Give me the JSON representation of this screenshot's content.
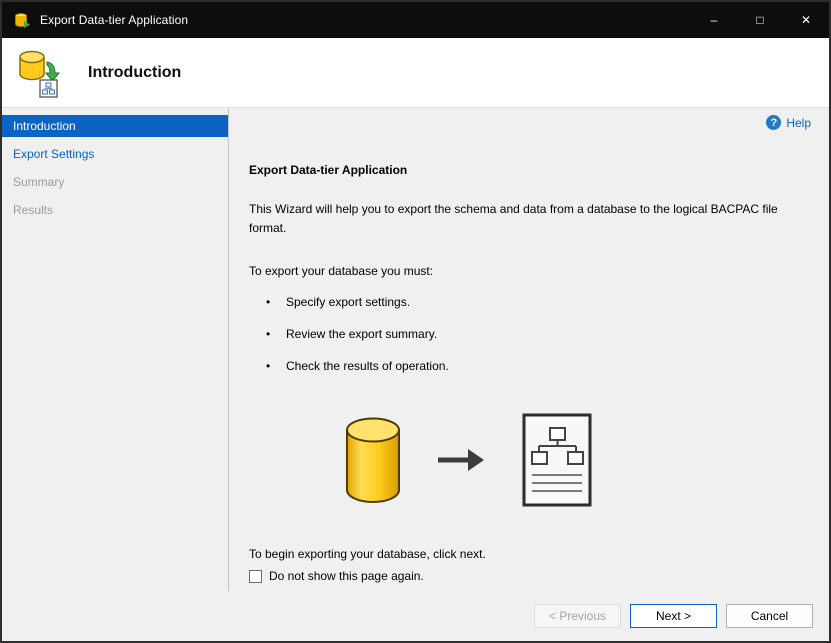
{
  "window": {
    "title": "Export Data-tier Application",
    "controls": {
      "minimize": "–",
      "maximize": "□",
      "close": "✕"
    }
  },
  "header": {
    "title": "Introduction"
  },
  "sidebar": {
    "items": [
      {
        "label": "Introduction",
        "state": "active"
      },
      {
        "label": "Export Settings",
        "state": "enabled"
      },
      {
        "label": "Summary",
        "state": "disabled"
      },
      {
        "label": "Results",
        "state": "disabled"
      }
    ]
  },
  "content": {
    "help_label": "Help",
    "heading": "Export Data-tier Application",
    "intro": "This Wizard will help you to export the schema and data from a database to the logical BACPAC file format.",
    "must_label": "To export your database you must:",
    "bullets": [
      "Specify export settings.",
      "Review the export summary.",
      "Check the results of operation."
    ],
    "begin_text": "To begin exporting your database, click next.",
    "checkbox_label": "Do not show this page again.",
    "checkbox_checked": false
  },
  "buttons": {
    "previous": "< Previous",
    "next": "Next >",
    "cancel": "Cancel"
  },
  "icons": {
    "help": "question-mark-in-blue-circle",
    "title_bar": "database-export-icon",
    "header": "database-export-icon",
    "illustration": [
      "database-cylinder",
      "arrow-right",
      "bacpac-file"
    ]
  },
  "colors": {
    "accent": "#0b64c4",
    "link": "#0066cc",
    "titlebar": "#0d0d0d",
    "background": "#f0f0f0",
    "database_yellow": "#ffcc1a"
  }
}
